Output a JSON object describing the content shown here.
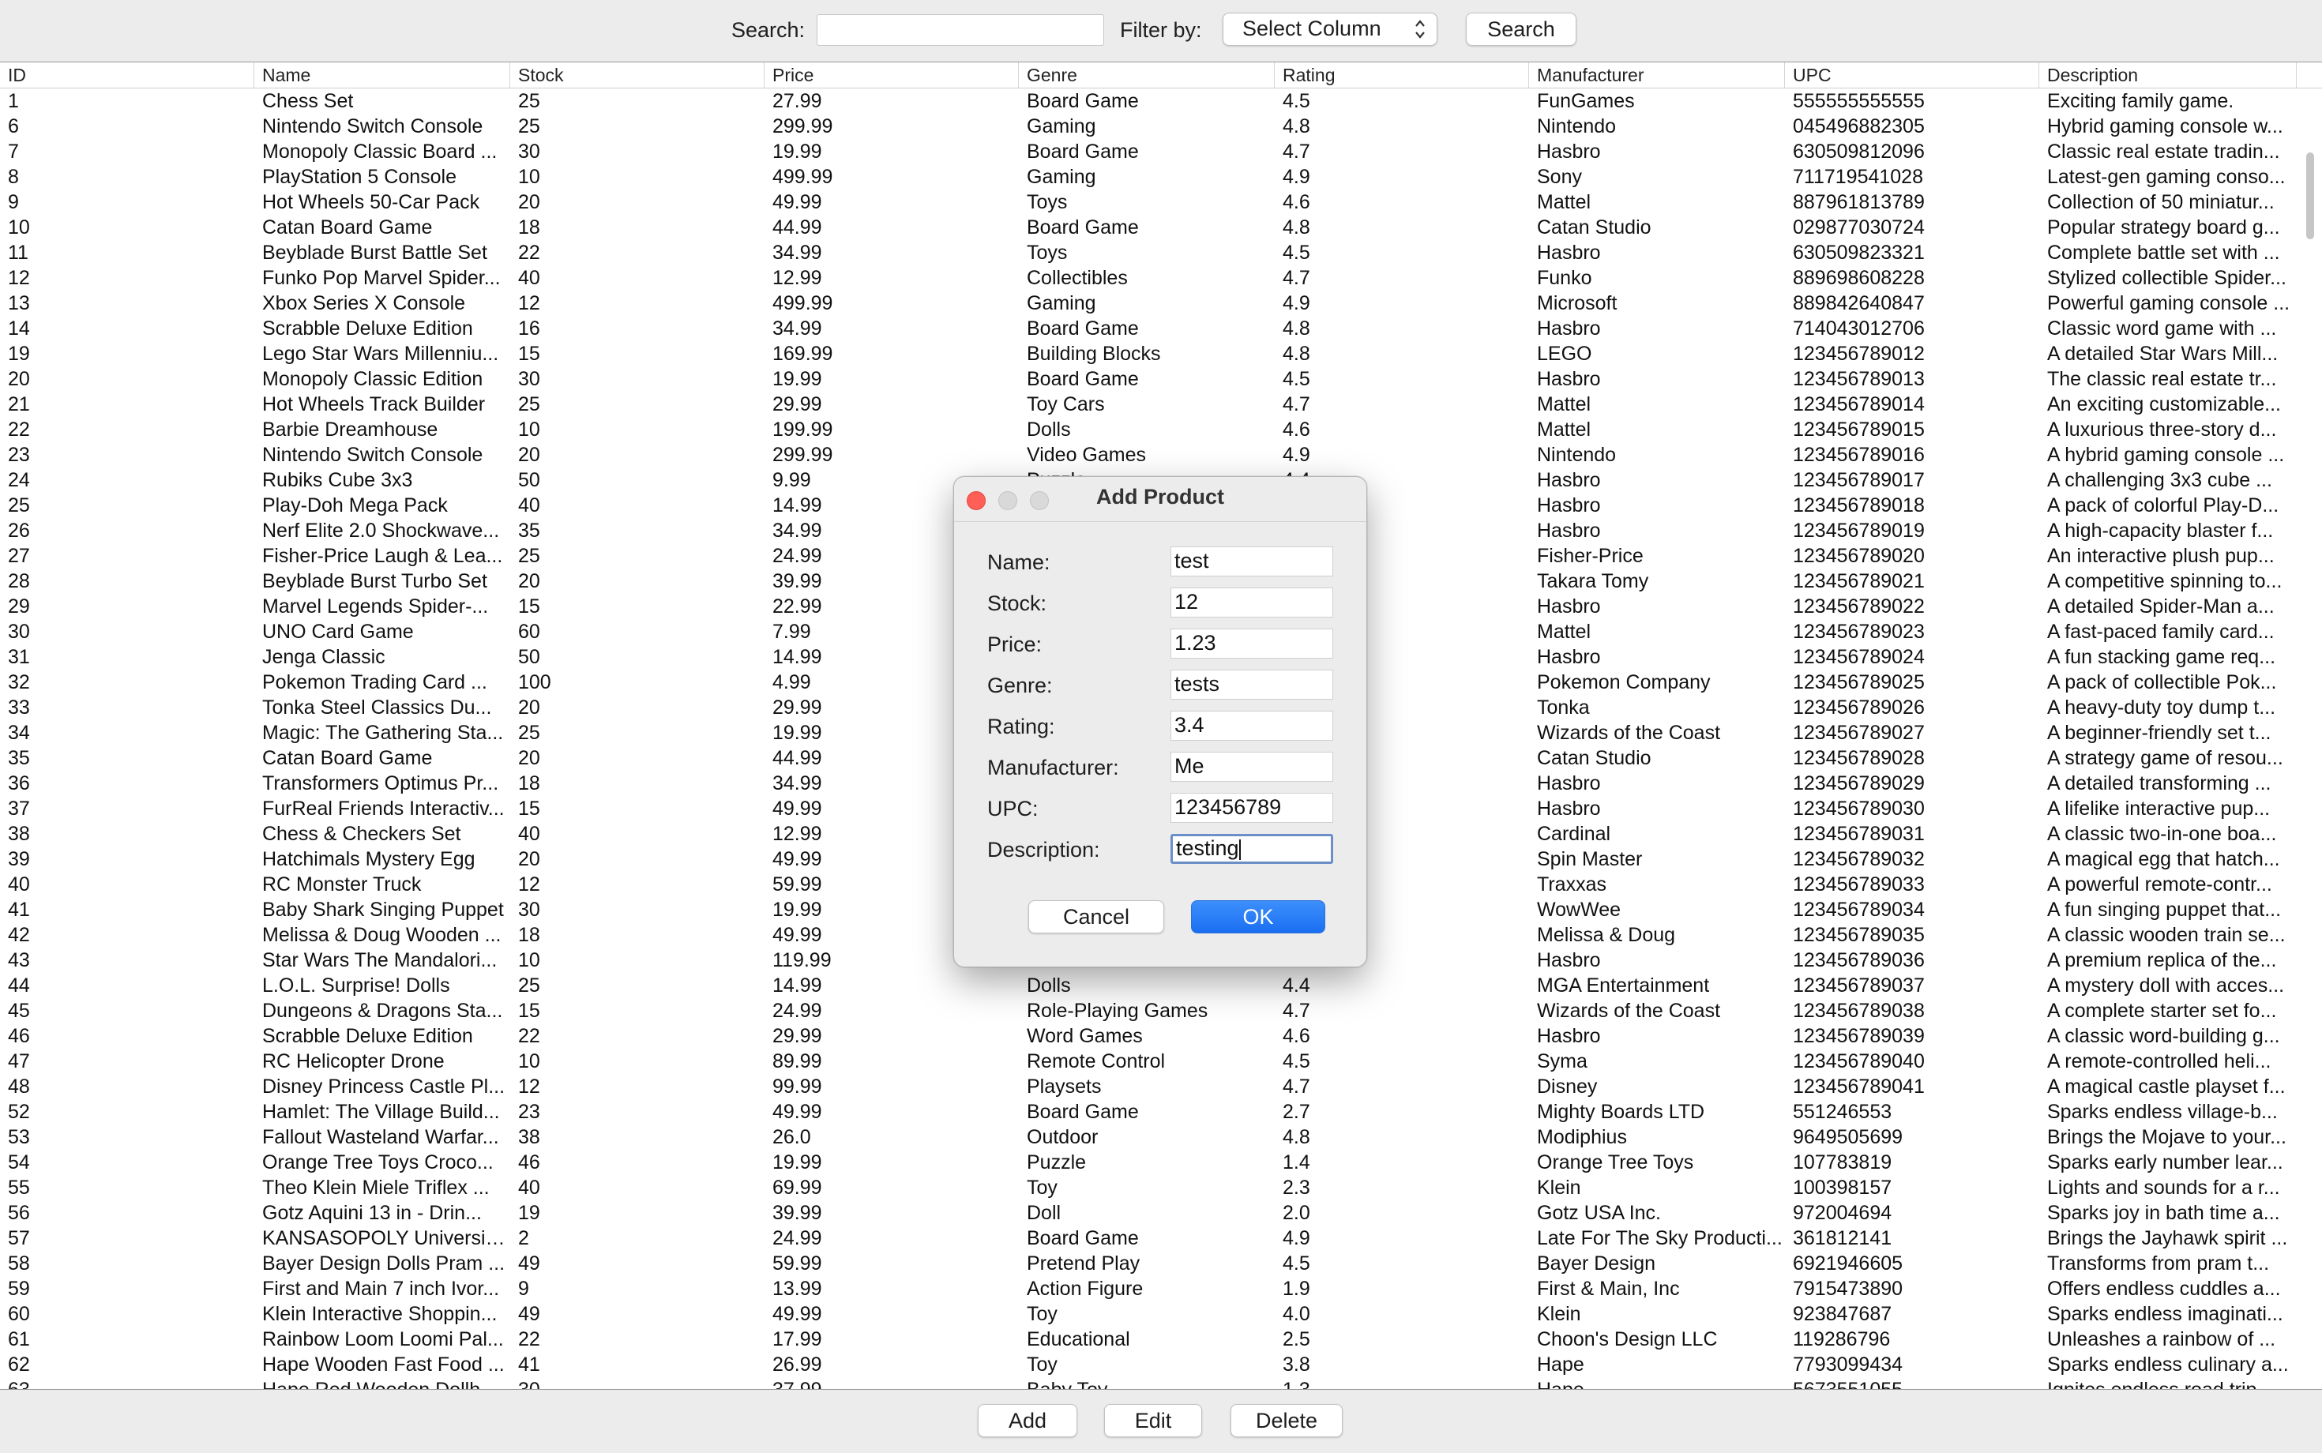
{
  "toolbar": {
    "search_label": "Search:",
    "search_value": "",
    "filter_label": "Filter by:",
    "filter_selected": "Select Column",
    "search_button": "Search"
  },
  "table": {
    "columns": [
      "ID",
      "Name",
      "Stock",
      "Price",
      "Genre",
      "Rating",
      "Manufacturer",
      "UPC",
      "Description"
    ],
    "rows": [
      [
        "1",
        "Chess Set",
        "25",
        "27.99",
        "Board Game",
        "4.5",
        "FunGames",
        "555555555555",
        "Exciting family game."
      ],
      [
        "6",
        "Nintendo Switch Console",
        "25",
        "299.99",
        "Gaming",
        "4.8",
        "Nintendo",
        "045496882305",
        "Hybrid gaming console w..."
      ],
      [
        "7",
        "Monopoly Classic Board ...",
        "30",
        "19.99",
        "Board Game",
        "4.7",
        "Hasbro",
        "630509812096",
        "Classic real estate tradin..."
      ],
      [
        "8",
        "PlayStation 5 Console",
        "10",
        "499.99",
        "Gaming",
        "4.9",
        "Sony",
        "711719541028",
        "Latest-gen gaming conso..."
      ],
      [
        "9",
        "Hot Wheels 50-Car Pack",
        "20",
        "49.99",
        "Toys",
        "4.6",
        "Mattel",
        "887961813789",
        "Collection of 50 miniatur..."
      ],
      [
        "10",
        "Catan Board Game",
        "18",
        "44.99",
        "Board Game",
        "4.8",
        "Catan Studio",
        "029877030724",
        "Popular strategy board g..."
      ],
      [
        "11",
        "Beyblade Burst Battle Set",
        "22",
        "34.99",
        "Toys",
        "4.5",
        "Hasbro",
        "630509823321",
        "Complete battle set with ..."
      ],
      [
        "12",
        "Funko Pop Marvel Spider...",
        "40",
        "12.99",
        "Collectibles",
        "4.7",
        "Funko",
        "889698608228",
        "Stylized collectible Spider..."
      ],
      [
        "13",
        "Xbox Series X Console",
        "12",
        "499.99",
        "Gaming",
        "4.9",
        "Microsoft",
        "889842640847",
        "Powerful gaming console ..."
      ],
      [
        "14",
        "Scrabble Deluxe Edition",
        "16",
        "34.99",
        "Board Game",
        "4.8",
        "Hasbro",
        "714043012706",
        "Classic word game with ..."
      ],
      [
        "19",
        "Lego Star Wars Millenniu...",
        "15",
        "169.99",
        "Building Blocks",
        "4.8",
        "LEGO",
        "123456789012",
        "A detailed Star Wars Mill..."
      ],
      [
        "20",
        "Monopoly Classic Edition",
        "30",
        "19.99",
        "Board Game",
        "4.5",
        "Hasbro",
        "123456789013",
        "The classic real estate tr..."
      ],
      [
        "21",
        "Hot Wheels Track Builder",
        "25",
        "29.99",
        "Toy Cars",
        "4.7",
        "Mattel",
        "123456789014",
        "An exciting customizable..."
      ],
      [
        "22",
        "Barbie Dreamhouse",
        "10",
        "199.99",
        "Dolls",
        "4.6",
        "Mattel",
        "123456789015",
        "A luxurious three-story d..."
      ],
      [
        "23",
        "Nintendo Switch Console",
        "20",
        "299.99",
        "Video Games",
        "4.9",
        "Nintendo",
        "123456789016",
        "A hybrid gaming console ..."
      ],
      [
        "24",
        "Rubiks Cube 3x3",
        "50",
        "9.99",
        "Puzzle",
        "4.4",
        "Hasbro",
        "123456789017",
        "A challenging 3x3 cube ..."
      ],
      [
        "25",
        "Play-Doh Mega Pack",
        "40",
        "14.99",
        "",
        "",
        "Hasbro",
        "123456789018",
        "A pack of colorful Play-D..."
      ],
      [
        "26",
        "Nerf Elite 2.0 Shockwave...",
        "35",
        "34.99",
        "",
        "",
        "Hasbro",
        "123456789019",
        "A high-capacity blaster f..."
      ],
      [
        "27",
        "Fisher-Price Laugh & Lea...",
        "25",
        "24.99",
        "",
        "",
        "Fisher-Price",
        "123456789020",
        "An interactive plush pup..."
      ],
      [
        "28",
        "Beyblade Burst Turbo Set",
        "20",
        "39.99",
        "",
        "",
        "Takara Tomy",
        "123456789021",
        "A competitive spinning to..."
      ],
      [
        "29",
        "Marvel Legends Spider-...",
        "15",
        "22.99",
        "",
        "",
        "Hasbro",
        "123456789022",
        "A detailed Spider-Man a..."
      ],
      [
        "30",
        "UNO Card Game",
        "60",
        "7.99",
        "",
        "",
        "Mattel",
        "123456789023",
        "A fast-paced family card..."
      ],
      [
        "31",
        "Jenga Classic",
        "50",
        "14.99",
        "",
        "",
        "Hasbro",
        "123456789024",
        "A fun stacking game req..."
      ],
      [
        "32",
        "Pokemon Trading Card ...",
        "100",
        "4.99",
        "",
        "",
        "Pokemon Company",
        "123456789025",
        "A pack of collectible Pok..."
      ],
      [
        "33",
        "Tonka Steel Classics Du...",
        "20",
        "29.99",
        "",
        "",
        "Tonka",
        "123456789026",
        "A heavy-duty toy dump t..."
      ],
      [
        "34",
        "Magic: The Gathering Sta...",
        "25",
        "19.99",
        "",
        "",
        "Wizards of the Coast",
        "123456789027",
        "A beginner-friendly set t..."
      ],
      [
        "35",
        "Catan Board Game",
        "20",
        "44.99",
        "",
        "",
        "Catan Studio",
        "123456789028",
        "A strategy game of resou..."
      ],
      [
        "36",
        "Transformers Optimus Pr...",
        "18",
        "34.99",
        "",
        "",
        "Hasbro",
        "123456789029",
        "A detailed transforming ..."
      ],
      [
        "37",
        "FurReal Friends Interactiv...",
        "15",
        "49.99",
        "",
        "",
        "Hasbro",
        "123456789030",
        "A lifelike interactive pup..."
      ],
      [
        "38",
        "Chess & Checkers Set",
        "40",
        "12.99",
        "",
        "",
        "Cardinal",
        "123456789031",
        "A classic two-in-one boa..."
      ],
      [
        "39",
        "Hatchimals Mystery Egg",
        "20",
        "49.99",
        "",
        "",
        "Spin Master",
        "123456789032",
        "A magical egg that hatch..."
      ],
      [
        "40",
        "RC Monster Truck",
        "12",
        "59.99",
        "",
        "",
        "Traxxas",
        "123456789033",
        "A powerful remote-contr..."
      ],
      [
        "41",
        "Baby Shark Singing Puppet",
        "30",
        "19.99",
        "",
        "",
        "WowWee",
        "123456789034",
        "A fun singing puppet that..."
      ],
      [
        "42",
        "Melissa & Doug Wooden ...",
        "18",
        "49.99",
        "",
        "",
        "Melissa & Doug",
        "123456789035",
        "A classic wooden train se..."
      ],
      [
        "43",
        "Star Wars The Mandalori...",
        "10",
        "119.99",
        "",
        "",
        "Hasbro",
        "123456789036",
        "A premium replica of the..."
      ],
      [
        "44",
        "L.O.L. Surprise! Dolls",
        "25",
        "14.99",
        "Dolls",
        "4.4",
        "MGA Entertainment",
        "123456789037",
        "A mystery doll with acces..."
      ],
      [
        "45",
        "Dungeons & Dragons Sta...",
        "15",
        "24.99",
        "Role-Playing Games",
        "4.7",
        "Wizards of the Coast",
        "123456789038",
        "A complete starter set fo..."
      ],
      [
        "46",
        "Scrabble Deluxe Edition",
        "22",
        "29.99",
        "Word Games",
        "4.6",
        "Hasbro",
        "123456789039",
        "A classic word-building g..."
      ],
      [
        "47",
        "RC Helicopter Drone",
        "10",
        "89.99",
        "Remote Control",
        "4.5",
        "Syma",
        "123456789040",
        "A remote-controlled heli..."
      ],
      [
        "48",
        "Disney Princess Castle Pl...",
        "12",
        "99.99",
        "Playsets",
        "4.7",
        "Disney",
        "123456789041",
        "A magical castle playset f..."
      ],
      [
        "52",
        "Hamlet: The Village Build...",
        "23",
        "49.99",
        "Board Game",
        "2.7",
        "Mighty Boards LTD",
        "551246553",
        "Sparks endless village-b..."
      ],
      [
        "53",
        "Fallout Wasteland Warfar...",
        "38",
        "26.0",
        "Outdoor",
        "4.8",
        "Modiphius",
        "9649505699",
        "Brings the Mojave to your..."
      ],
      [
        "54",
        "Orange Tree Toys Croco...",
        "46",
        "19.99",
        "Puzzle",
        "1.4",
        "Orange Tree Toys",
        "107783819",
        "Sparks early number lear..."
      ],
      [
        "55",
        "Theo Klein Miele Triflex ...",
        "40",
        "69.99",
        "Toy",
        "2.3",
        "Klein",
        "100398157",
        "Lights and sounds for a r..."
      ],
      [
        "56",
        "Gotz Aquini 13 in - Drin...",
        "19",
        "39.99",
        "Doll",
        "2.0",
        "Gotz USA Inc.",
        "972004694",
        "Sparks joy in bath time a..."
      ],
      [
        "57",
        "KANSASOPOLY University ...",
        "2",
        "24.99",
        "Board Game",
        "4.9",
        "Late For The Sky Producti...",
        "361812141",
        "Brings the Jayhawk spirit ..."
      ],
      [
        "58",
        "Bayer Design Dolls Pram ...",
        "49",
        "59.99",
        "Pretend Play",
        "4.5",
        "Bayer Design",
        "6921946605",
        "Transforms from pram t..."
      ],
      [
        "59",
        "First and Main 7 inch Ivor...",
        "9",
        "13.99",
        "Action Figure",
        "1.9",
        "First & Main, Inc",
        "7915473890",
        "Offers endless cuddles a..."
      ],
      [
        "60",
        "Klein Interactive Shoppin...",
        "49",
        "49.99",
        "Toy",
        "4.0",
        "Klein",
        "923847687",
        "Sparks endless imaginati..."
      ],
      [
        "61",
        "Rainbow Loom Loomi Pal...",
        "22",
        "17.99",
        "Educational",
        "2.5",
        "Choon's Design LLC",
        "119286796",
        "Unleashes a rainbow of ..."
      ],
      [
        "62",
        "Hape Wooden Fast Food ...",
        "41",
        "26.99",
        "Toy",
        "3.8",
        "Hape",
        "7793099434",
        "Sparks endless culinary a..."
      ],
      [
        "63",
        "Hape Red Wooden Dollh...",
        "30",
        "37.99",
        "Baby Toy",
        "1.3",
        "Hape",
        "5673551055",
        "Ignites endless road trip..."
      ]
    ]
  },
  "actions": {
    "add": "Add",
    "edit": "Edit",
    "delete": "Delete"
  },
  "dialog": {
    "title": "Add Product",
    "fields": [
      {
        "label": "Name:",
        "value": "test"
      },
      {
        "label": "Stock:",
        "value": "12"
      },
      {
        "label": "Price:",
        "value": "1.23"
      },
      {
        "label": "Genre:",
        "value": "tests"
      },
      {
        "label": "Rating:",
        "value": "3.4"
      },
      {
        "label": "Manufacturer:",
        "value": "Me"
      },
      {
        "label": "UPC:",
        "value": "123456789"
      },
      {
        "label": "Description:",
        "value": "testing"
      }
    ],
    "cancel": "Cancel",
    "ok": "OK"
  },
  "colors": {
    "accent": "#1a6ff2",
    "close_light": "#ff5f57",
    "focus_ring": "#6c8fc7"
  }
}
